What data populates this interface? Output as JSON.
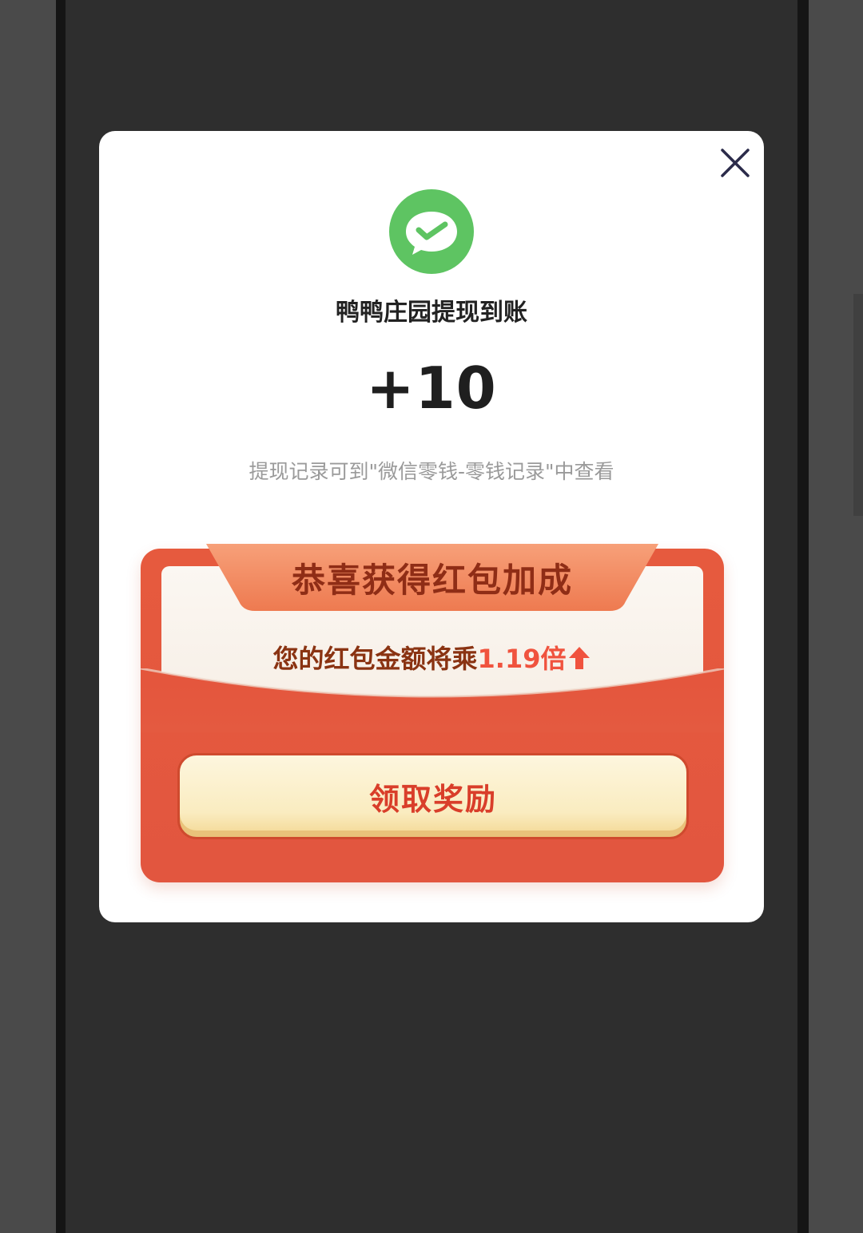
{
  "dialog": {
    "title": "鸭鸭庄园提现到账",
    "amount": "+10",
    "hint": "提现记录可到\"微信零钱-零钱记录\"中查看"
  },
  "bonus": {
    "ribbon_title": "恭喜获得红包加成",
    "multiplier_prefix": "您的红包金额将乘",
    "multiplier_value": "1.19倍",
    "claim_label": "领取奖励"
  },
  "colors": {
    "wechat_green": "#5ec462",
    "card_red": "#e35a3f",
    "ribbon_orange": "#f08a5a",
    "button_cream": "#fbefc6"
  },
  "icons": [
    "close-icon",
    "wechat-pay-icon",
    "up-arrow-icon"
  ]
}
